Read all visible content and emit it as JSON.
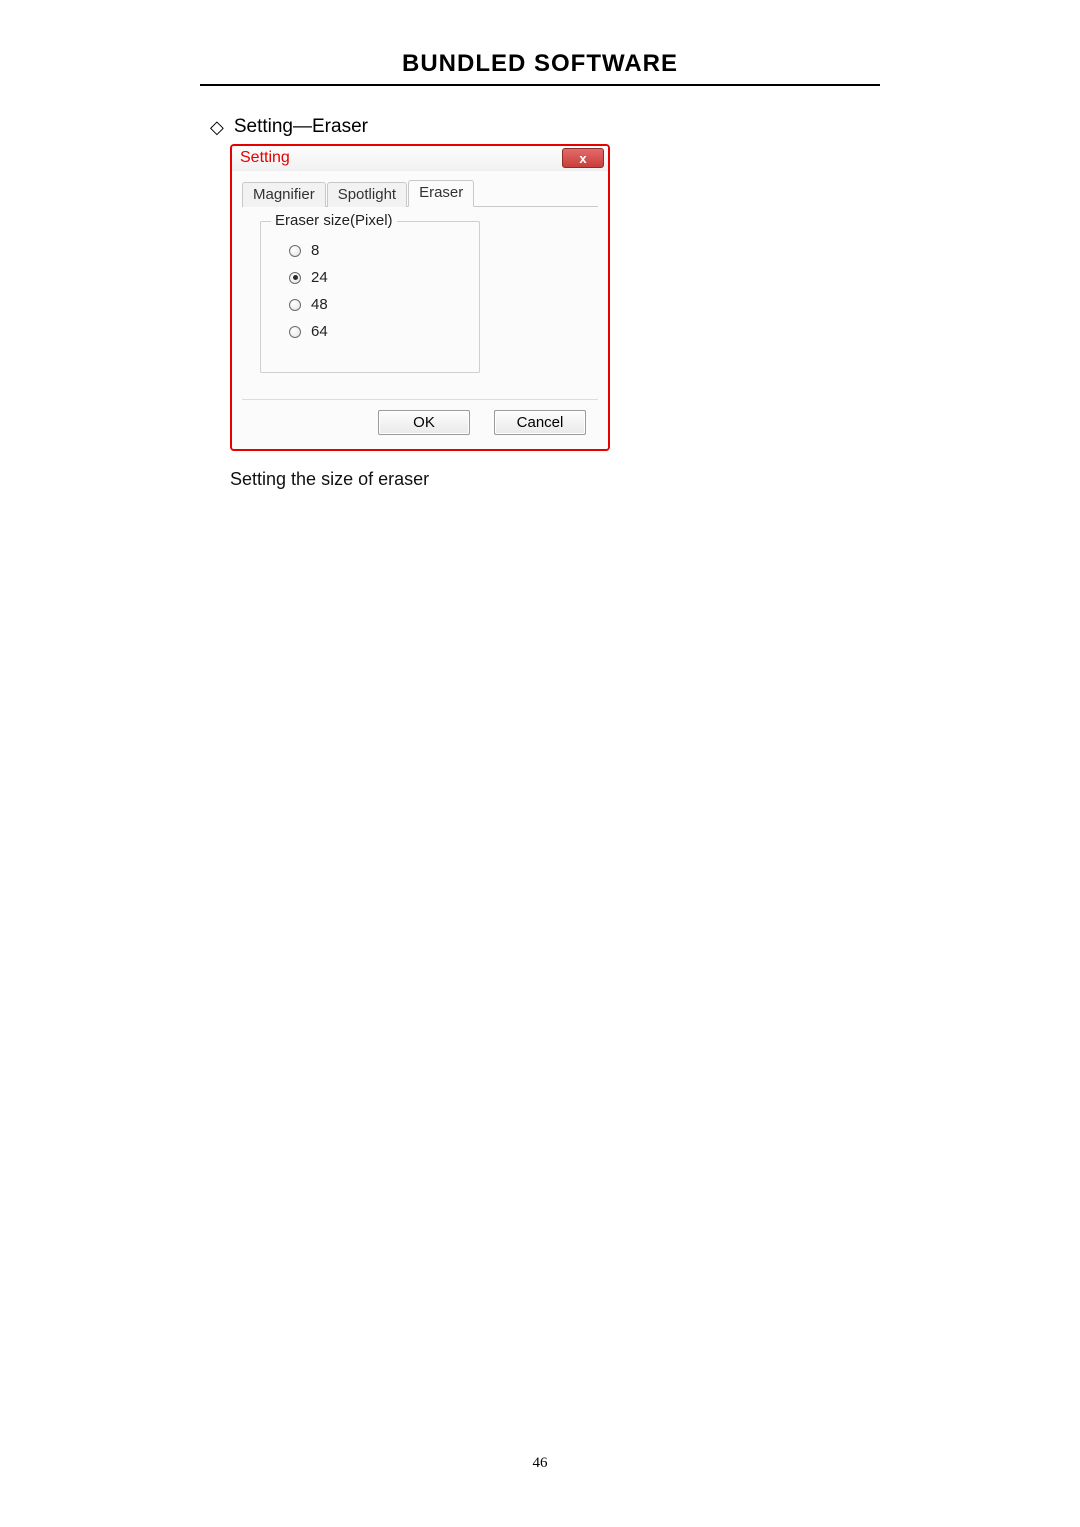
{
  "page": {
    "headerTitle": "BUNDLED SOFTWARE",
    "bulletText": "Setting—Eraser",
    "caption": "Setting the size of eraser",
    "pageNumber": "46"
  },
  "dialog": {
    "title": "Setting",
    "closeGlyph": "x",
    "tabs": {
      "magnifier": "Magnifier",
      "spotlight": "Spotlight",
      "eraser": "Eraser"
    },
    "activeTab": "eraser",
    "group": {
      "legend": "Eraser size(Pixel)",
      "options": {
        "o0": "8",
        "o1": "24",
        "o2": "48",
        "o3": "64"
      },
      "selected": "o1"
    },
    "buttons": {
      "ok": "OK",
      "cancel": "Cancel"
    }
  }
}
